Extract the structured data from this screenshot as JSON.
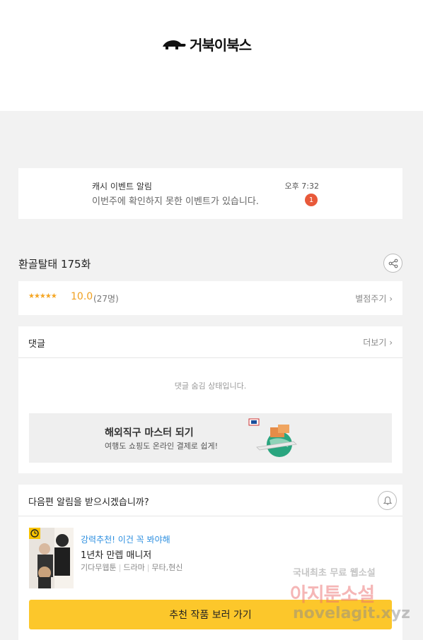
{
  "header": {
    "logo_text": "거북이북스"
  },
  "notice": {
    "title": "캐시 이벤트 알림",
    "message": "이번주에 확인하지 못한 이벤트가 있습니다.",
    "time": "오후 7:32",
    "badge_count": "1"
  },
  "episode": {
    "title": "환골탈태 175화"
  },
  "rating": {
    "stars": "★★★★★",
    "score": "10.0",
    "count": "(27명)",
    "rate_link": "별점주기 ›"
  },
  "comments": {
    "title": "댓글",
    "more_link": "더보기 ›",
    "hidden_message": "댓글 숨김 상태입니다."
  },
  "ad": {
    "title": "해외직구 마스터 되기",
    "subtitle": "여행도 쇼핑도 온라인 결제로 쉽게!"
  },
  "next": {
    "question": "다음편 알림을 받으시겠습니까?",
    "recommend_tag": "강력추천! 이건 꼭 봐야해",
    "recommend_title": "1년차 만렙 매니저",
    "recommend_meta": [
      "기다무웹툰",
      "드라마",
      "무타,현신"
    ],
    "cta_label": "추천 작품 보러 가기"
  },
  "watermark": {
    "line1": "국내최초 무료 웹소설",
    "line2": "아지툰소설",
    "line3": "novelagit.xyz"
  },
  "colors": {
    "accent_yellow": "#fcc72b",
    "badge_red": "#e8593a",
    "star_orange": "#f5a623",
    "link_blue": "#2d8fe0"
  }
}
